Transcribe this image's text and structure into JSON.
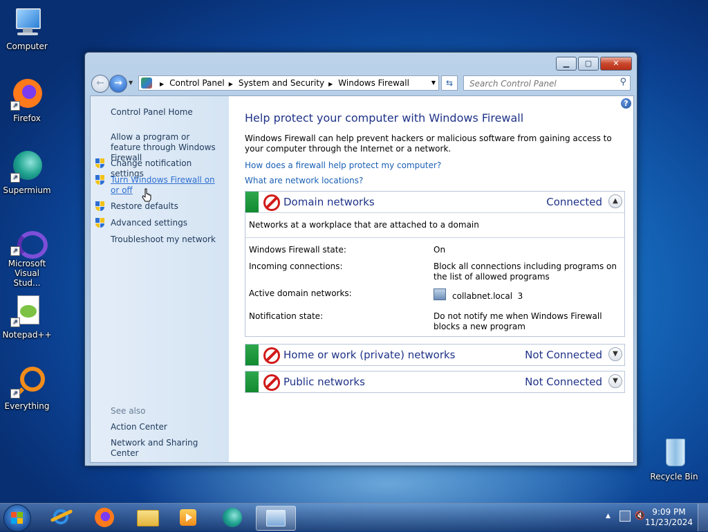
{
  "desktop": {
    "icons": [
      {
        "label": "Computer"
      },
      {
        "label": "Firefox"
      },
      {
        "label": "Supermium"
      },
      {
        "label": "Microsoft Visual Stud..."
      },
      {
        "label": "Notepad++"
      },
      {
        "label": "Everything"
      },
      {
        "label": "Recycle Bin"
      }
    ]
  },
  "window": {
    "caption_buttons": {
      "minimize": "▁",
      "maximize": "▢",
      "close": "✕"
    },
    "address": {
      "crumbs": [
        "Control Panel",
        "System and Security",
        "Windows Firewall"
      ]
    },
    "search": {
      "placeholder": "Search Control Panel"
    },
    "sidebar": {
      "home": "Control Panel Home",
      "allow_program": "Allow a program or feature through Windows Firewall",
      "change_notification": "Change notification settings",
      "turn_on_off": "Turn Windows Firewall on or off",
      "restore_defaults": "Restore defaults",
      "advanced_settings": "Advanced settings",
      "troubleshoot": "Troubleshoot my network",
      "see_also": "See also",
      "action_center": "Action Center",
      "network_sharing": "Network and Sharing Center"
    },
    "main": {
      "title": "Help protect your computer with Windows Firewall",
      "intro": "Windows Firewall can help prevent hackers or malicious software from gaining access to your computer through the Internet or a network.",
      "link_how": "How does a firewall help protect my computer?",
      "link_locations": "What are network locations?",
      "domain": {
        "name": "Domain networks",
        "status": "Connected",
        "description": "Networks at a workplace that are attached to a domain",
        "rows": {
          "state_k": "Windows Firewall state:",
          "state_v": "On",
          "incoming_k": "Incoming connections:",
          "incoming_v": "Block all connections including programs on the list of allowed programs",
          "active_k": "Active domain networks:",
          "active_v": "collabnet.local  3",
          "notify_k": "Notification state:",
          "notify_v": "Do not notify me when Windows Firewall blocks a new program"
        }
      },
      "private": {
        "name": "Home or work (private) networks",
        "status": "Not Connected"
      },
      "public": {
        "name": "Public networks",
        "status": "Not Connected"
      }
    }
  },
  "taskbar": {
    "clock_time": "9:09 PM",
    "clock_date": "11/23/2024"
  },
  "colors": {
    "accent": "#1e3287",
    "link": "#1a5fb4",
    "status_green": "#128a30",
    "block_red": "#d11a1a"
  }
}
